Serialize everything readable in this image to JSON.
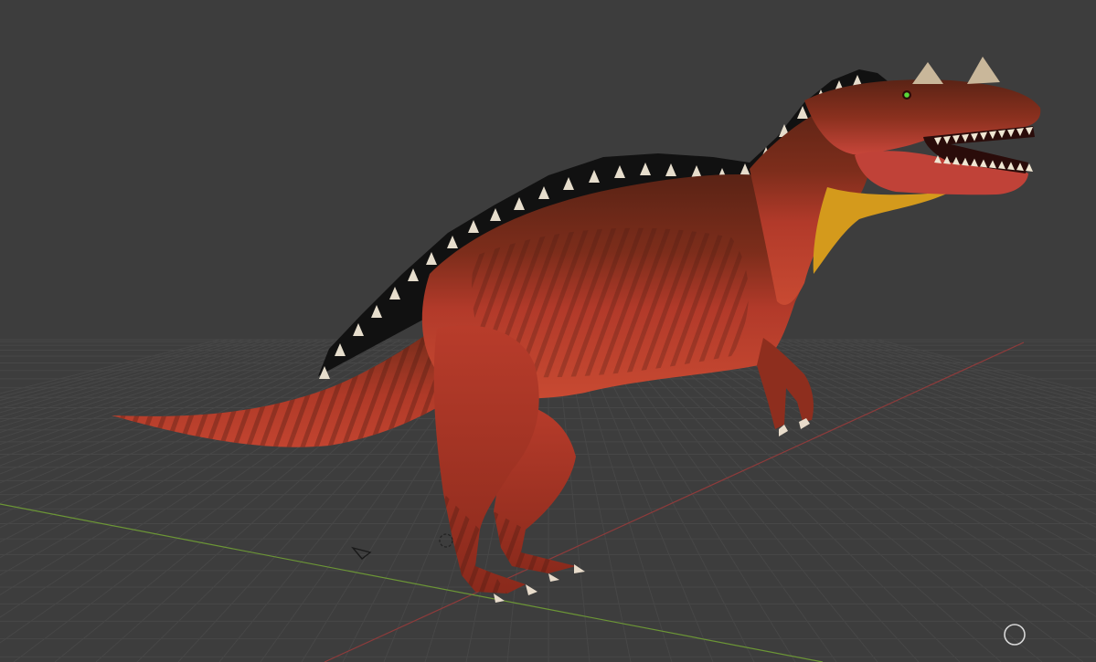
{
  "viewport": {
    "background": "#3d3d3d",
    "grid_color": "#4a4a4a",
    "x_axis_color": "#9b3a3a",
    "y_axis_color": "#6f9a3a"
  },
  "model": {
    "body_color": "#b23a2a",
    "back_color": "#5a2315",
    "belly_color": "#d4542f",
    "throat_color": "#d9a21a",
    "sail_color": "#111111",
    "spike_color": "#e8e0d0",
    "claw_color": "#e8dccb",
    "eye_color": "#58d838"
  },
  "icons": {
    "record": "circle-icon",
    "camera": "camera-gizmo-icon",
    "cursor": "3d-cursor-icon"
  }
}
